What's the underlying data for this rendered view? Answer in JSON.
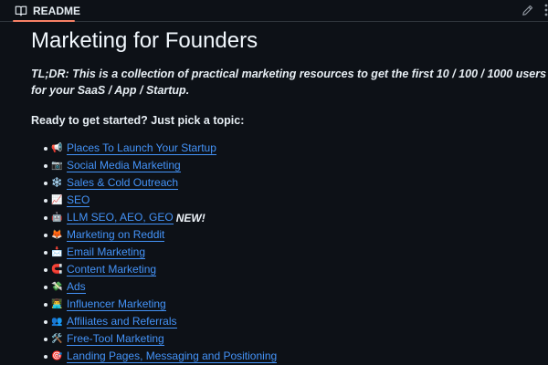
{
  "tab": {
    "label": "README",
    "icon": "book-icon"
  },
  "toolbar": {
    "edit_icon": "pencil-icon",
    "more_icon": "kebab-icon"
  },
  "readme": {
    "title": "Marketing for Founders",
    "tldr": "TL;DR: This is a collection of practical marketing resources to get the first 10 / 100 / 1000 users for your SaaS / App / Startup.",
    "prompt": "Ready to get started? Just pick a topic:"
  },
  "topics": [
    {
      "emoji": "📢",
      "label": "Places To Launch Your Startup",
      "badge": ""
    },
    {
      "emoji": "📷",
      "label": "Social Media Marketing",
      "badge": ""
    },
    {
      "emoji": "❄️",
      "label": "Sales & Cold Outreach",
      "badge": ""
    },
    {
      "emoji": "📈",
      "label": "SEO",
      "badge": ""
    },
    {
      "emoji": "🤖",
      "label": "LLM SEO, AEO, GEO",
      "badge": "NEW!"
    },
    {
      "emoji": "🦊",
      "label": "Marketing on Reddit",
      "badge": ""
    },
    {
      "emoji": "📩",
      "label": "Email Marketing",
      "badge": ""
    },
    {
      "emoji": "🧲",
      "label": "Content Marketing",
      "badge": ""
    },
    {
      "emoji": "💸",
      "label": "Ads",
      "badge": ""
    },
    {
      "emoji": "👨‍💻",
      "label": "Influencer Marketing",
      "badge": ""
    },
    {
      "emoji": "👥",
      "label": "Affiliates and Referrals",
      "badge": ""
    },
    {
      "emoji": "🛠️",
      "label": "Free-Tool Marketing",
      "badge": ""
    },
    {
      "emoji": "🎯",
      "label": "Landing Pages, Messaging and Positioning",
      "badge": ""
    }
  ],
  "colors": {
    "background": "#0d1117",
    "link": "#4493f8",
    "tab_underline": "#f78166",
    "text": "#e6edf3"
  }
}
